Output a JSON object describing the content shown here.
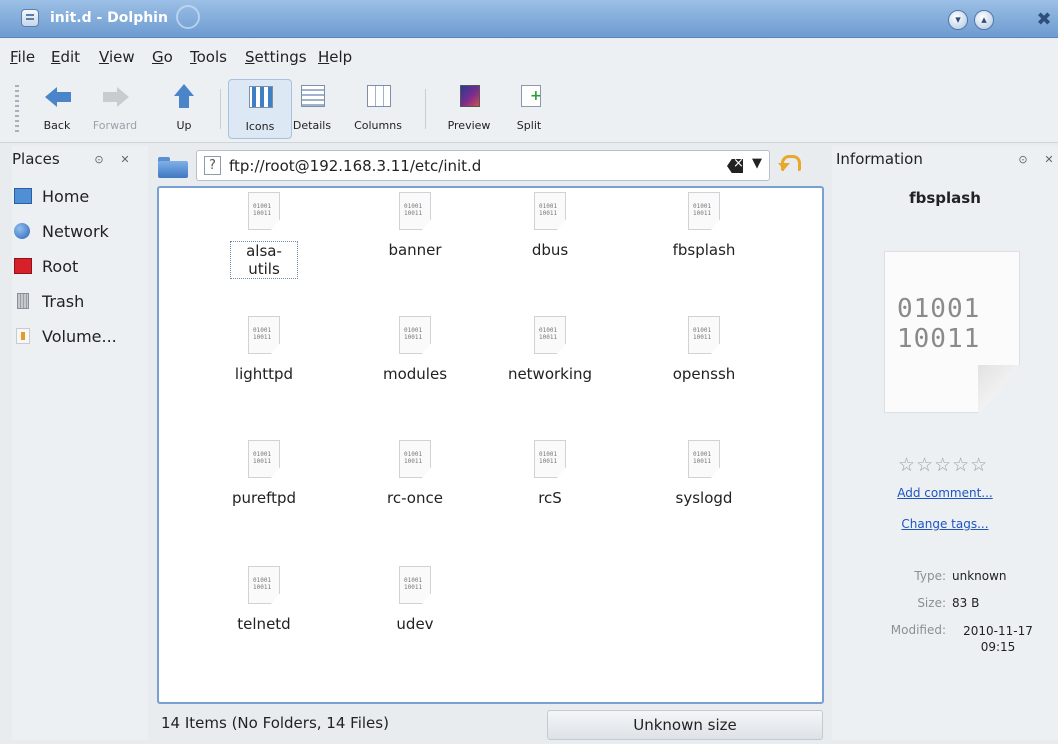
{
  "window": {
    "title": "init.d - Dolphin"
  },
  "menu": [
    "File",
    "Edit",
    "View",
    "Go",
    "Tools",
    "Settings",
    "Help"
  ],
  "toolbar": {
    "back": "Back",
    "forward": "Forward",
    "up": "Up",
    "icons": "Icons",
    "details": "Details",
    "columns": "Columns",
    "preview": "Preview",
    "split": "Split"
  },
  "places": {
    "title": "Places",
    "items": [
      "Home",
      "Network",
      "Root",
      "Trash",
      "Volume..."
    ]
  },
  "location": {
    "url": "ftp://root@192.168.3.11/etc/init.d"
  },
  "files": [
    "alsa-utils",
    "banner",
    "dbus",
    "fbsplash",
    "lighttpd",
    "modules",
    "networking",
    "openssh",
    "pureftpd",
    "rc-once",
    "rcS",
    "syslogd",
    "telnetd",
    "udev"
  ],
  "file_icon_text": "01001\n10011",
  "status": {
    "items": "14 Items (No Folders, 14 Files)",
    "size": "Unknown size"
  },
  "info": {
    "title": "Information",
    "name": "fbsplash",
    "preview_text": "01001\n10011",
    "rating": "☆☆☆☆☆",
    "add_comment": "Add comment...",
    "change_tags": "Change tags...",
    "type_label": "Type:",
    "type_value": "unknown",
    "size_label": "Size:",
    "size_value": "83 B",
    "modified_label": "Modified:",
    "modified_value": "2010-11-17 09:15"
  },
  "colors": {
    "accent": "#7a9fd3",
    "link": "#1f55c0"
  }
}
